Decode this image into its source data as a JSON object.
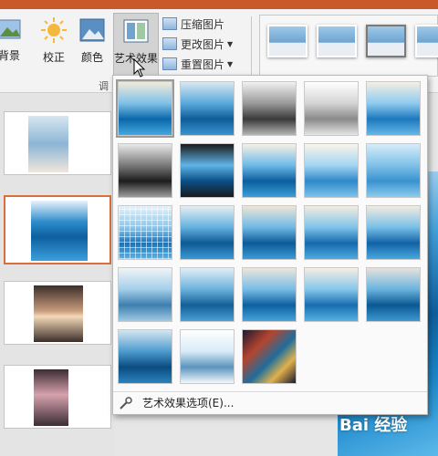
{
  "ribbon": {
    "buttons": [
      {
        "label": "背景",
        "icon": "remove-background-icon"
      },
      {
        "label": "校正",
        "icon": "corrections-icon"
      },
      {
        "label": "颜色",
        "icon": "color-icon"
      },
      {
        "label": "艺术效果",
        "icon": "artistic-effects-icon"
      }
    ],
    "small_commands": [
      {
        "label": "压缩图片",
        "icon": "compress-pictures-icon"
      },
      {
        "label": "更改图片",
        "icon": "change-picture-icon"
      },
      {
        "label": "重置图片",
        "icon": "reset-picture-icon"
      }
    ],
    "group_label": "调",
    "picture_styles_count": 4
  },
  "gallery": {
    "rows": 5,
    "effects_count": 23,
    "options_label": "艺术效果选项(E)...",
    "options_icon": "artistic-effects-options-icon"
  },
  "watermark": "Bai 经验",
  "colors": {
    "title_bar": "#c9582a",
    "selected_slide_border": "#d6713f",
    "ribbon_bg": "#f3f3f3",
    "gallery_bg": "#fafafa"
  }
}
